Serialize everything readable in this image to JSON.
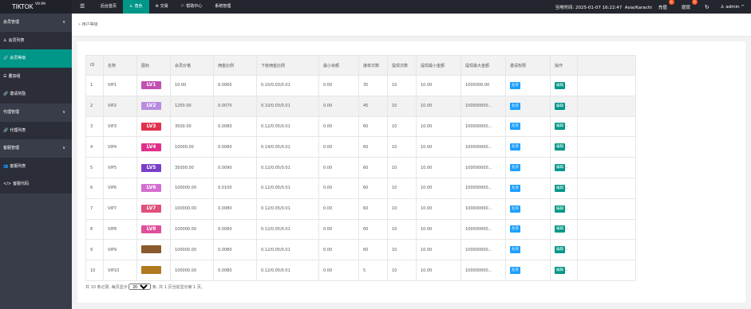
{
  "header": {
    "logo": "TIKTOK",
    "version": "V9.99",
    "menu_icon": "hamburger-icon",
    "nav": [
      {
        "label": "后台首页",
        "icon": "",
        "active": false
      },
      {
        "label": "角色",
        "icon": "user-icon",
        "icon_glyph": "♙",
        "active": true
      },
      {
        "label": "交易",
        "icon": "exchange-icon",
        "icon_glyph": "⊜",
        "active": false
      },
      {
        "label": "帮助中心",
        "icon": "flag-icon",
        "icon_glyph": "⚐",
        "active": false
      },
      {
        "label": "系统管理",
        "icon": "",
        "active": false
      }
    ],
    "datetime_label": "当地时间:",
    "datetime": "2025-01-07 16:22:47",
    "timezone": "Asia/Karachi",
    "recharge_label": "充值",
    "recharge_badge": "0",
    "withdraw_label": "提现",
    "withdraw_badge": "0",
    "refresh_icon": "refresh-icon",
    "user_icon": "user-icon",
    "user": "admin",
    "caret": "^"
  },
  "sidebar": {
    "items": [
      {
        "label": "会员管理",
        "type": "group",
        "icon": "",
        "chevron": "∨"
      },
      {
        "label": "会员列表",
        "type": "child",
        "icon": "user-icon",
        "glyph": "♙"
      },
      {
        "label": "会员等级",
        "type": "active",
        "icon": "link-icon",
        "glyph": "🔗"
      },
      {
        "label": "叠加组",
        "type": "child",
        "icon": "list-icon",
        "glyph": "☰"
      },
      {
        "label": "邀请奖励",
        "type": "child",
        "icon": "link-icon",
        "glyph": "🔗"
      },
      {
        "label": "代理管理",
        "type": "group",
        "icon": "",
        "chevron": "∨"
      },
      {
        "label": "代理列表",
        "type": "child",
        "icon": "link-icon",
        "glyph": "🔗"
      },
      {
        "label": "客服管理",
        "type": "group",
        "icon": "",
        "chevron": "∨"
      },
      {
        "label": "客服列表",
        "type": "child",
        "icon": "users-icon",
        "glyph": "👥"
      },
      {
        "label": "客服代码",
        "type": "child",
        "icon": "code-icon",
        "glyph": "</>"
      }
    ]
  },
  "breadcrumb": {
    "arrow": "»",
    "label": "用户等级"
  },
  "table": {
    "headers": [
      "ID",
      "名称",
      "图标",
      "会员价格",
      "佣金比例",
      "下级佣金比例",
      "最小余额",
      "接单次数",
      "提现次数",
      "提现最小金额",
      "提现最大金额",
      "邀请权限",
      "操作"
    ],
    "allow_label": "允许",
    "edit_label": "编辑",
    "rows": [
      {
        "id": "1",
        "name": "VIP1",
        "badge": "LV1",
        "badge_color": "#c24fb3",
        "price": "10.00",
        "commission": "0.0060",
        "sub_commission": "0.10/0.03/0.01",
        "min_balance": "0.00",
        "orders": "35",
        "withdraw_times": "10",
        "withdraw_min": "10.00",
        "withdraw_max": "1000000.00"
      },
      {
        "id": "2",
        "name": "VIP2",
        "badge": "LV2",
        "badge_color": "#b98be0",
        "price": "1250.00",
        "commission": "0.0070",
        "sub_commission": "0.10/0.03/0.01",
        "min_balance": "0.00",
        "orders": "45",
        "withdraw_times": "10",
        "withdraw_min": "10.00",
        "withdraw_max": "100000000..."
      },
      {
        "id": "3",
        "name": "VIP3",
        "badge": "LV3",
        "badge_color": "#e0314f",
        "price": "3500.00",
        "commission": "0.0080",
        "sub_commission": "0.12/0.05/0.01",
        "min_balance": "0.00",
        "orders": "60",
        "withdraw_times": "10",
        "withdraw_min": "10.00",
        "withdraw_max": "100000000..."
      },
      {
        "id": "4",
        "name": "VIP4",
        "badge": "LV4",
        "badge_color": "#e02f8a",
        "price": "10000.00",
        "commission": "0.0080",
        "sub_commission": "0.14/0.05/0.01",
        "min_balance": "0.00",
        "orders": "60",
        "withdraw_times": "10",
        "withdraw_min": "10.00",
        "withdraw_max": "100000000..."
      },
      {
        "id": "5",
        "name": "VIP5",
        "badge": "LV5",
        "badge_color": "#7a3fc9",
        "price": "35000.00",
        "commission": "0.0090",
        "sub_commission": "0.12/0.05/0.01",
        "min_balance": "0.00",
        "orders": "60",
        "withdraw_times": "10",
        "withdraw_min": "10.00",
        "withdraw_max": "100000000..."
      },
      {
        "id": "6",
        "name": "VIP6",
        "badge": "LV6",
        "badge_color": "#d66ed0",
        "price": "100000.00",
        "commission": "0.0100",
        "sub_commission": "0.12/0.05/0.01",
        "min_balance": "0.00",
        "orders": "60",
        "withdraw_times": "10",
        "withdraw_min": "10.00",
        "withdraw_max": "100000000..."
      },
      {
        "id": "7",
        "name": "VIP7",
        "badge": "LV7",
        "badge_color": "#e0507a",
        "price": "100000.00",
        "commission": "0.0080",
        "sub_commission": "0.12/0.05/0.01",
        "min_balance": "0.00",
        "orders": "60",
        "withdraw_times": "10",
        "withdraw_min": "10.00",
        "withdraw_max": "100000000..."
      },
      {
        "id": "8",
        "name": "VIP8",
        "badge": "LV8",
        "badge_color": "#e04f9b",
        "price": "100000.00",
        "commission": "0.0080",
        "sub_commission": "0.12/0.05/0.01",
        "min_balance": "0.00",
        "orders": "60",
        "withdraw_times": "10",
        "withdraw_min": "10.00",
        "withdraw_max": "100000000..."
      },
      {
        "id": "9",
        "name": "VIP9",
        "badge": "",
        "badge_color": "#8a5a2e",
        "price": "100000.00",
        "commission": "0.0080",
        "sub_commission": "0.12/0.05/0.01",
        "min_balance": "0.00",
        "orders": "60",
        "withdraw_times": "10",
        "withdraw_min": "10.00",
        "withdraw_max": "100000000..."
      },
      {
        "id": "10",
        "name": "VIP10",
        "badge": "",
        "badge_color": "#b07a20",
        "price": "100000.00",
        "commission": "0.0080",
        "sub_commission": "0.12/0.05/0.01",
        "min_balance": "0.00",
        "orders": "5",
        "withdraw_times": "10",
        "withdraw_min": "10.00",
        "withdraw_max": "100000000..."
      }
    ]
  },
  "footer": {
    "prefix": "共 10 条记录, 每页显示",
    "page_size": "20",
    "suffix": "条, 共 1 页当前显示第 1 页。"
  },
  "colors": {
    "accent": "#009688",
    "blue": "#1e9fff",
    "dark": "#23262e",
    "sidebar": "#393d49"
  }
}
